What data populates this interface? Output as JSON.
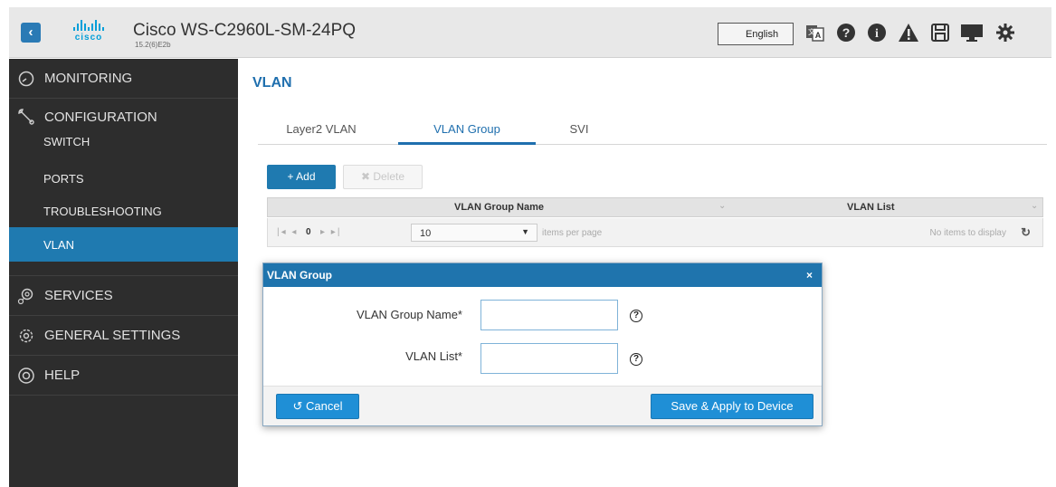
{
  "header": {
    "logo_text": "cisco",
    "device_name": "Cisco WS-C2960L-SM-24PQ",
    "version": "15.2(6)E2b",
    "language": "English",
    "icons": [
      "back-arrow-icon",
      "language-icon",
      "question-circle-icon",
      "info-circle-icon",
      "warning-icon",
      "save-icon",
      "monitor-icon",
      "gear-icon"
    ]
  },
  "sidebar": {
    "monitoring": "MONITORING",
    "configuration": "CONFIGURATION",
    "sub_items": [
      {
        "label": "SWITCH"
      },
      {
        "label": "PORTS"
      },
      {
        "label": "TROUBLESHOOTING"
      },
      {
        "label": "VLAN",
        "active": true
      }
    ],
    "services": "SERVICES",
    "general_settings": "GENERAL SETTINGS",
    "help": "HELP"
  },
  "main": {
    "title": "VLAN",
    "tabs": [
      {
        "label": "Layer2 VLAN"
      },
      {
        "label": "VLAN Group",
        "active": true
      },
      {
        "label": "SVI"
      }
    ],
    "add_label": "+ Add",
    "delete_label": "✖ Delete",
    "grid": {
      "columns": [
        "VLAN Group Name",
        "VLAN List"
      ],
      "page": "0",
      "per_page": "10",
      "per_page_label": "items per page",
      "empty_text": "No items to display"
    }
  },
  "modal": {
    "title": "VLAN Group",
    "close": "×",
    "fields": [
      {
        "label": "VLAN Group Name*",
        "value": ""
      },
      {
        "label": "VLAN List*",
        "value": ""
      }
    ],
    "cancel_label": "Cancel",
    "save_label": "Save & Apply to Device"
  },
  "colors": {
    "accent": "#1f7ab0",
    "sidebar_bg": "#2d2d2d",
    "header_bg": "#e8e8e8",
    "modal_header": "#1f74ad"
  }
}
